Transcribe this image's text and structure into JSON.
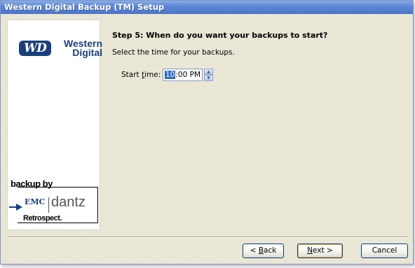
{
  "window": {
    "title": "Western Digital Backup (TM) Setup"
  },
  "sidebar": {
    "wd_badge": "WD",
    "wd_line1": "Western",
    "wd_line2": "Digital",
    "backup_by": "backup by",
    "emc": "EMC",
    "dantz": "dantz",
    "retrospect": "Retrospect."
  },
  "main": {
    "step_title": "Step 5: When do you want your backups to start?",
    "step_description": "Select the time for your backups.",
    "start_time_label_pre": "Start ",
    "start_time_label_accel": "t",
    "start_time_label_post": "ime:",
    "time_hour": "10",
    "time_rest": ":00 PM",
    "spin_up": "▲",
    "spin_down": "▼"
  },
  "buttons": {
    "back_pre": "< ",
    "back_accel": "B",
    "back_post": "ack",
    "next_accel": "N",
    "next_post": "ext >",
    "cancel": "Cancel"
  }
}
